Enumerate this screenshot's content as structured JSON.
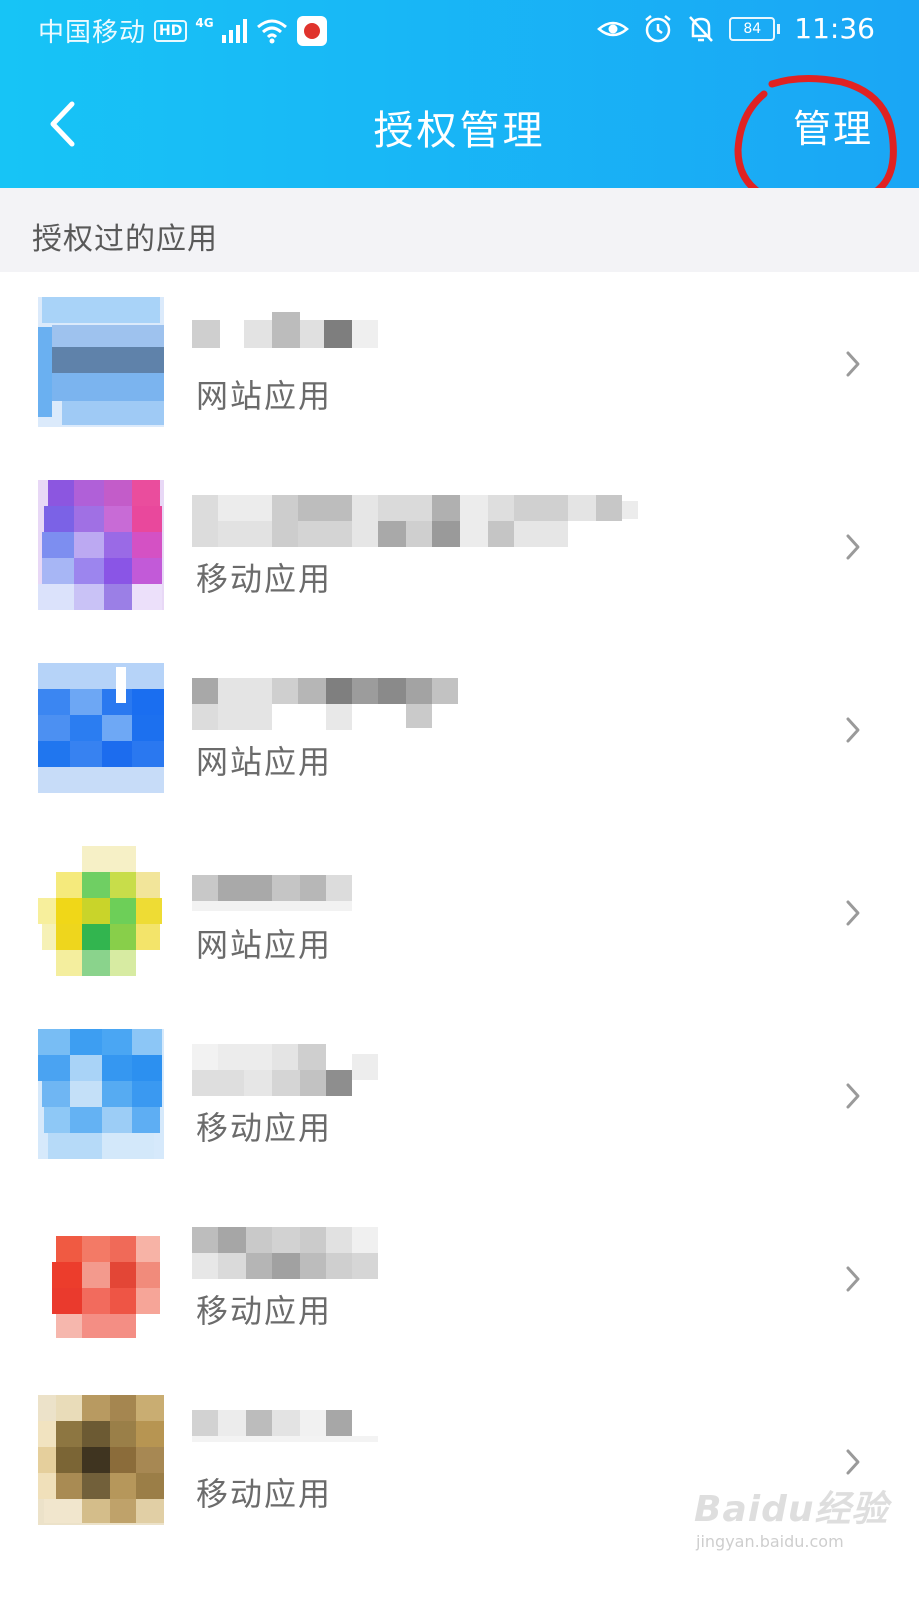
{
  "status_bar": {
    "carrier": "中国移动",
    "hd_badge": "HD",
    "network_type": "4G",
    "battery_level": "84",
    "time": "11:36",
    "icons": [
      "signal-icon",
      "wifi-icon",
      "baidu-app-icon",
      "eye-icon",
      "alarm-icon",
      "mute-icon",
      "battery-icon"
    ]
  },
  "navbar": {
    "back_icon": "chevron-left-icon",
    "title": "授权管理",
    "manage_label": "管理"
  },
  "section": {
    "title": "授权过的应用"
  },
  "apps": [
    {
      "type": "网站应用",
      "icon_color": "#5aa9ee"
    },
    {
      "type": "移动应用",
      "icon_color": "#9b59d6"
    },
    {
      "type": "网站应用",
      "icon_color": "#2f7ef2"
    },
    {
      "type": "网站应用",
      "icon_color": "#e9d21f"
    },
    {
      "type": "移动应用",
      "icon_color": "#3a9ff0"
    },
    {
      "type": "移动应用",
      "icon_color": "#ec4c3c"
    },
    {
      "type": "移动应用",
      "icon_color": "#8a7040"
    }
  ],
  "watermark": {
    "brand": "Baidu经验",
    "url": "jingyan.baidu.com"
  },
  "colors": {
    "header_start": "#17c4f6",
    "header_end": "#1aa6f5",
    "annotation_red": "#e02222",
    "section_bg": "#f3f3f6"
  }
}
